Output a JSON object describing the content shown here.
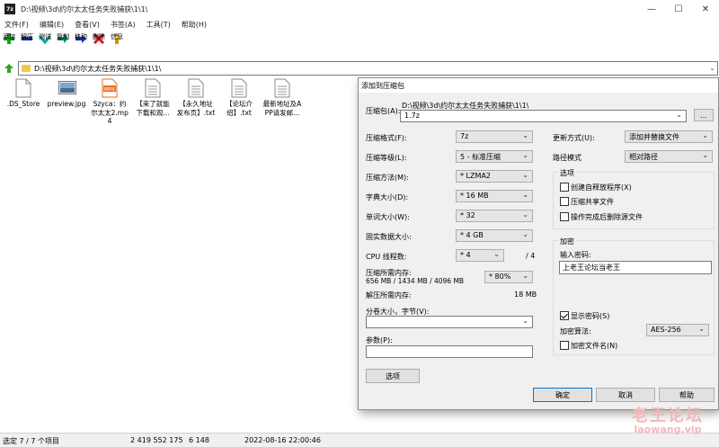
{
  "window": {
    "title": "D:\\视频\\3d\\约尔太太任务失败捕获\\1\\1\\",
    "icon_text": "7z",
    "controls": [
      "—",
      "☐",
      "✕"
    ]
  },
  "menu": [
    "文件(F)",
    "编辑(E)",
    "查看(V)",
    "书签(A)",
    "工具(T)",
    "帮助(H)"
  ],
  "toolbar": {
    "add": "添加",
    "extract": "解压",
    "test": "测试",
    "copy": "复制",
    "move": "移动",
    "delete": "删除",
    "info": "信息"
  },
  "path": "D:\\视频\\3d\\约尔太太任务失败捕获\\1\\1\\",
  "files": [
    {
      "name": ".DS_Store",
      "kind": "doc"
    },
    {
      "name": "preview.jpg",
      "kind": "image"
    },
    {
      "name": "Szyca：约尔太太2.mp4",
      "kind": "video"
    },
    {
      "name": "【来了就能下载和观...",
      "kind": "doc"
    },
    {
      "name": "【永久地址发布页】.txt",
      "kind": "doc"
    },
    {
      "name": "【论坛介绍】.txt",
      "kind": "doc"
    },
    {
      "name": "最新地址及APP请发邮...",
      "kind": "doc"
    }
  ],
  "status": {
    "selected": "选定 7 / 7 个项目",
    "size": "2 419 552 175",
    "packed": "6 148",
    "date": "2022-08-16 22:00:46"
  },
  "dialog": {
    "title": "添加到压缩包",
    "archive_label": "压缩包(A):",
    "archive_dir": "D:\\视频\\3d\\约尔太太任务失败捕获\\1\\1\\",
    "archive_name": "1.7z",
    "browse": "...",
    "format_label": "压缩格式(F):",
    "format": "7z",
    "level_label": "压缩等级(L):",
    "level": "5 - 标准压缩",
    "method_label": "压缩方法(M):",
    "method": "* LZMA2",
    "dict_label": "字典大小(D):",
    "dict": "* 16 MB",
    "word_label": "单词大小(W):",
    "word": "* 32",
    "solid_label": "固实数据大小:",
    "solid": "* 4 GB",
    "cpu_label": "CPU 线程数:",
    "cpu": "* 4",
    "cpu_total": "/ 4",
    "mem_label": "压缩所需内存:",
    "mem_values": "656 MB / 1434 MB / 4096 MB",
    "mem_pct": "* 80%",
    "demem_label": "解压所需内存:",
    "demem_value": "18 MB",
    "split_label": "分卷大小，字节(V):",
    "params_label": "参数(P):",
    "options_btn": "选项",
    "update_label": "更新方式(U):",
    "update": "添加并替换文件",
    "pathmode_label": "路径模式",
    "pathmode": "相对路径",
    "options_group": "选项",
    "opt_sfx": "创建自释放程序(X)",
    "opt_shared": "压缩共享文件",
    "opt_delete": "操作完成后删除源文件",
    "enc_group": "加密",
    "pwd_label": "输入密码:",
    "pwd_value": "上老王论坛当老王",
    "show_pwd": "显示密码(S)",
    "enc_method_label": "加密算法:",
    "enc_method": "AES-256",
    "enc_names": "加密文件名(N)",
    "ok": "确定",
    "cancel": "取消",
    "help": "帮助"
  },
  "watermark": {
    "line1": "老王论坛",
    "line2": "laowang.vip"
  }
}
